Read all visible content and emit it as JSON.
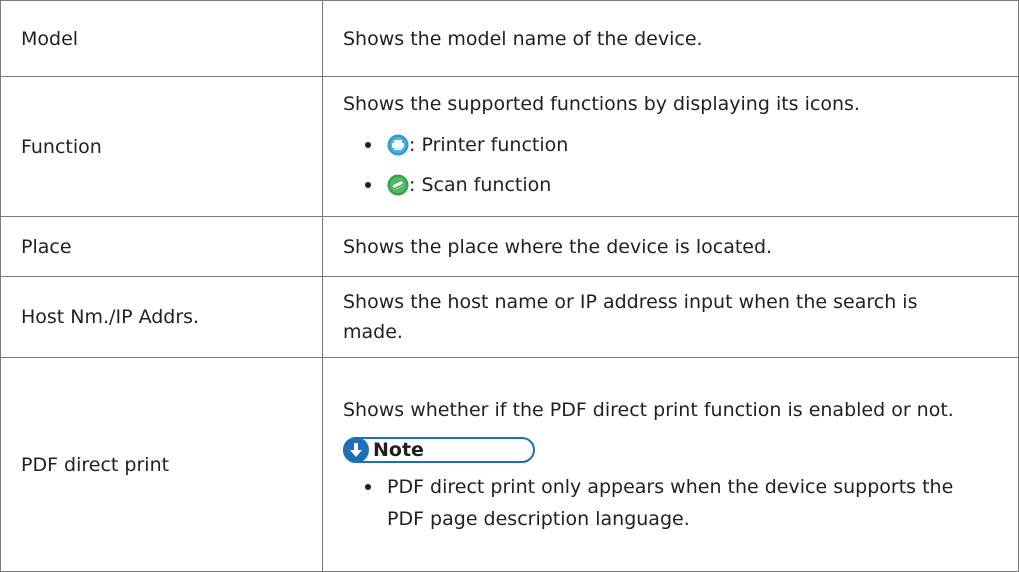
{
  "rows": [
    {
      "term": "Model",
      "desc": "Shows the model name of the device."
    },
    {
      "term": "Function",
      "desc": "Shows the supported functions by displaying its icons.",
      "bullets": [
        {
          "icon": "printer-function-icon",
          "color": "#2e9ad0",
          "text": ": Printer function"
        },
        {
          "icon": "scan-function-icon",
          "color": "#3aa24a",
          "text": ": Scan function"
        }
      ]
    },
    {
      "term": "Place",
      "desc": "Shows the place where the device is located."
    },
    {
      "term": "Host Nm./IP Addrs.",
      "desc_line1": "Shows the host name or IP address input when the search is",
      "desc_line2": "made."
    },
    {
      "term": "PDF direct print",
      "desc": "Shows whether if the PDF direct print function is enabled or not.",
      "note_label": "Note",
      "note_line1": "PDF direct print only appears when the device supports the",
      "note_line2": "PDF page description language."
    }
  ],
  "colors": {
    "note_accent": "#1e6fb8",
    "border": "#7a7a7a",
    "text": "#231f20"
  }
}
